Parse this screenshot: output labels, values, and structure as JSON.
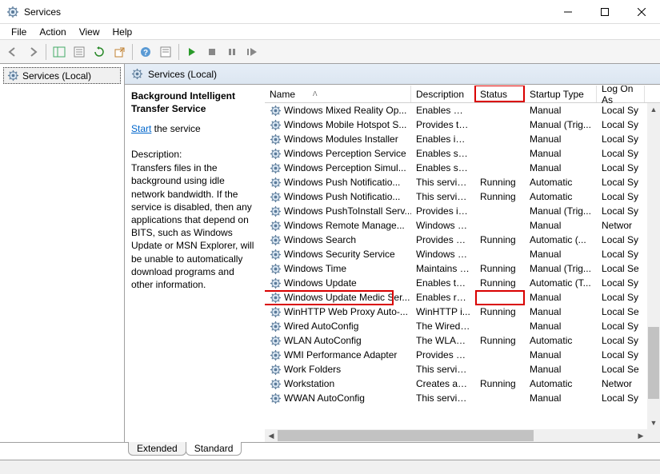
{
  "window": {
    "title": "Services"
  },
  "menu": {
    "items": [
      "File",
      "Action",
      "View",
      "Help"
    ]
  },
  "leftPane": {
    "label": "Services (Local)"
  },
  "paneHeader": {
    "label": "Services (Local)"
  },
  "detail": {
    "selectedName": "Background Intelligent Transfer Service",
    "actionPrefix": "Start",
    "actionSuffix": " the service",
    "descLabel": "Description:",
    "description": "Transfers files in the background using idle network bandwidth. If the service is disabled, then any applications that depend on BITS, such as Windows Update or MSN Explorer, will be unable to automatically download programs and other information."
  },
  "columns": {
    "name": "Name",
    "description": "Description",
    "status": "Status",
    "startupType": "Startup Type",
    "logOnAs": "Log On As"
  },
  "tabs": {
    "extended": "Extended",
    "standard": "Standard"
  },
  "services": [
    {
      "name": "Windows Mixed Reality Op...",
      "desc": "Enables Mix...",
      "status": "",
      "startup": "Manual",
      "logon": "Local Sy"
    },
    {
      "name": "Windows Mobile Hotspot S...",
      "desc": "Provides th...",
      "status": "",
      "startup": "Manual (Trig...",
      "logon": "Local Sy"
    },
    {
      "name": "Windows Modules Installer",
      "desc": "Enables inst...",
      "status": "",
      "startup": "Manual",
      "logon": "Local Sy"
    },
    {
      "name": "Windows Perception Service",
      "desc": "Enables spa...",
      "status": "",
      "startup": "Manual",
      "logon": "Local Sy"
    },
    {
      "name": "Windows Perception Simul...",
      "desc": "Enables spa...",
      "status": "",
      "startup": "Manual",
      "logon": "Local Sy"
    },
    {
      "name": "Windows Push Notificatio...",
      "desc": "This service ...",
      "status": "Running",
      "startup": "Automatic",
      "logon": "Local Sy"
    },
    {
      "name": "Windows Push Notificatio...",
      "desc": "This service ...",
      "status": "Running",
      "startup": "Automatic",
      "logon": "Local Sy"
    },
    {
      "name": "Windows PushToInstall Serv...",
      "desc": "Provides inf...",
      "status": "",
      "startup": "Manual (Trig...",
      "logon": "Local Sy"
    },
    {
      "name": "Windows Remote Manage...",
      "desc": "Windows R...",
      "status": "",
      "startup": "Manual",
      "logon": "Networ"
    },
    {
      "name": "Windows Search",
      "desc": "Provides co...",
      "status": "Running",
      "startup": "Automatic (...",
      "logon": "Local Sy"
    },
    {
      "name": "Windows Security Service",
      "desc": "Windows Se...",
      "status": "",
      "startup": "Manual",
      "logon": "Local Sy"
    },
    {
      "name": "Windows Time",
      "desc": "Maintains d...",
      "status": "Running",
      "startup": "Manual (Trig...",
      "logon": "Local Se"
    },
    {
      "name": "Windows Update",
      "desc": "Enables the ...",
      "status": "Running",
      "startup": "Automatic (T...",
      "logon": "Local Sy"
    },
    {
      "name": "Windows Update Medic Ser...",
      "desc": "Enables rem...",
      "status": "",
      "startup": "Manual",
      "logon": "Local Sy"
    },
    {
      "name": "WinHTTP Web Proxy Auto-...",
      "desc": "WinHTTP i...",
      "status": "Running",
      "startup": "Manual",
      "logon": "Local Se"
    },
    {
      "name": "Wired AutoConfig",
      "desc": "The Wired A...",
      "status": "",
      "startup": "Manual",
      "logon": "Local Sy"
    },
    {
      "name": "WLAN AutoConfig",
      "desc": "The WLANS...",
      "status": "Running",
      "startup": "Automatic",
      "logon": "Local Sy"
    },
    {
      "name": "WMI Performance Adapter",
      "desc": "Provides pe...",
      "status": "",
      "startup": "Manual",
      "logon": "Local Sy"
    },
    {
      "name": "Work Folders",
      "desc": "This service ...",
      "status": "",
      "startup": "Manual",
      "logon": "Local Se"
    },
    {
      "name": "Workstation",
      "desc": "Creates and...",
      "status": "Running",
      "startup": "Automatic",
      "logon": "Networ"
    },
    {
      "name": "WWAN AutoConfig",
      "desc": "This service ...",
      "status": "",
      "startup": "Manual",
      "logon": "Local Sy"
    }
  ]
}
